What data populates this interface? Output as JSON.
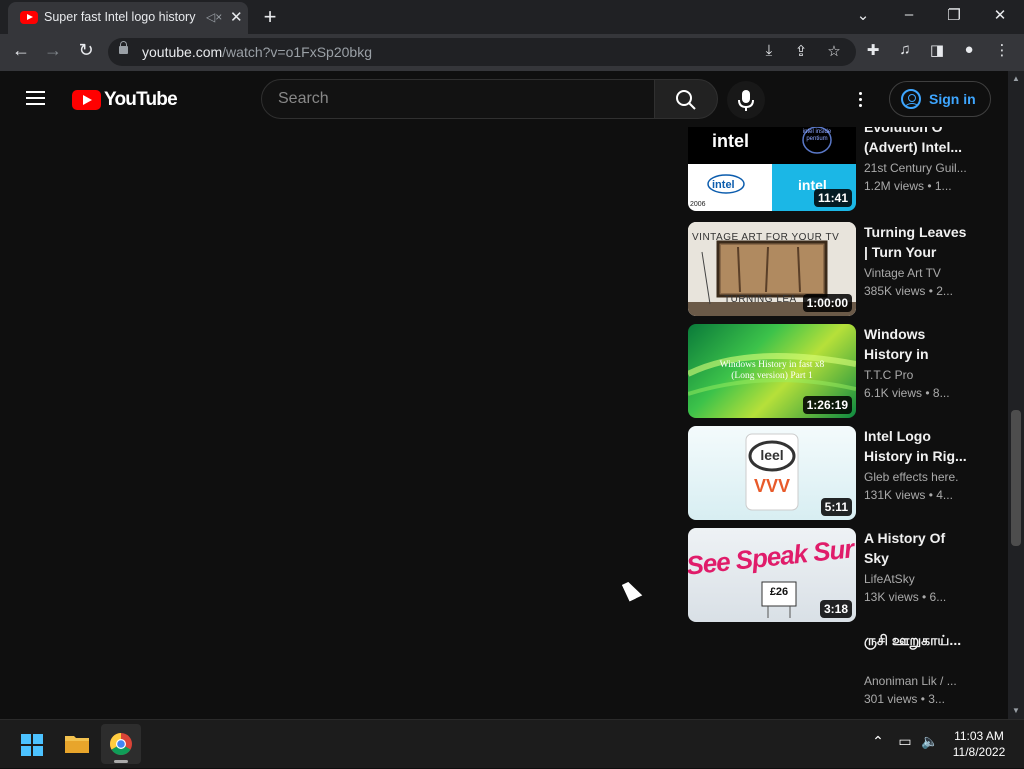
{
  "browser": {
    "tab_title": "Super fast Intel logo history",
    "tab_mute_icon": "speaker-muted-icon",
    "new_tab_label": "+",
    "url_host": "youtube.com",
    "url_path": "/watch?v=o1FxSp20bkg"
  },
  "youtube": {
    "logo_text": "YouTube",
    "search_placeholder": "Search",
    "sign_in_label": "Sign in",
    "brand_color": "#ff0000",
    "link_color": "#3ea6ff"
  },
  "videos": [
    {
      "title": "Evolution Of (Advert) Intel...",
      "channel": "21st Century Guil...",
      "meta": "1.2M views  • 1...",
      "duration": "11:41",
      "thumb_text_1": "intel",
      "thumb_text_2": "intel inside pentium",
      "thumb_text_3": "intel",
      "thumb_text_4": "intel",
      "thumb_text_5": "2006"
    },
    {
      "title": "Turning Leaves | Turn Your TV...",
      "channel": "Vintage Art TV",
      "meta": "385K views  • 2...",
      "duration": "1:00:00",
      "thumb_text_1": "VINTAGE ART FOR YOUR TV",
      "thumb_text_2": "TURNING LEA"
    },
    {
      "title": "Windows History in fast...",
      "channel": "T.T.C Pro",
      "meta": "6.1K views  • 8...",
      "duration": "1:26:19",
      "thumb_text_1": "Windows History in fast x8 (Long version) Part 1"
    },
    {
      "title": "Intel Logo History in Rig...",
      "channel": "Gleb effects here.",
      "meta": "131K views  • 4...",
      "duration": "5:11",
      "thumb_text_1": "leel",
      "thumb_text_2": "VVV"
    },
    {
      "title": "A History Of Sky",
      "channel": "LifeAtSky",
      "meta": "13K views  • 6...",
      "duration": "3:18",
      "thumb_text_1": "See Speak Sur",
      "thumb_text_2": "£26"
    },
    {
      "title": "ருசி ஊறுகாய்...",
      "channel": "Anoniman Lik / ...",
      "meta": "301 views  • 3..."
    }
  ],
  "taskbar": {
    "time": "11:03 AM",
    "date": "11/8/2022"
  }
}
